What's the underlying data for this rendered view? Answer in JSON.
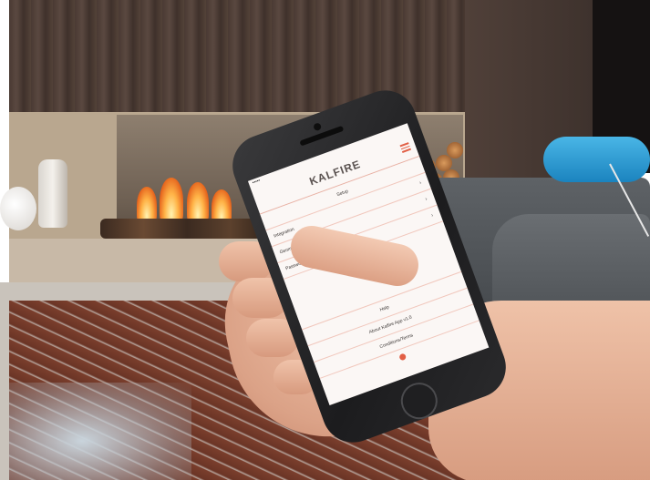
{
  "app": {
    "brand": "KALFIRE",
    "brand_sub": "",
    "status_left": "••••• ",
    "status_time": "",
    "status_right": "",
    "title": "Setup",
    "settings_rows": [
      "Integration",
      "Geometry",
      "Password"
    ],
    "footer_rows": [
      "Help",
      "About Kalfire App v1.0",
      "Conditions/Terms"
    ]
  },
  "colors": {
    "accent": "#e25f45",
    "divider": "#f1c7bc",
    "screen_bg": "#fbf7f5",
    "cushion": "#2a9ad3",
    "rug": "#6b3526"
  },
  "icons": [
    "hamburger-menu-icon",
    "chevron-right-icon",
    "flame-icon"
  ]
}
